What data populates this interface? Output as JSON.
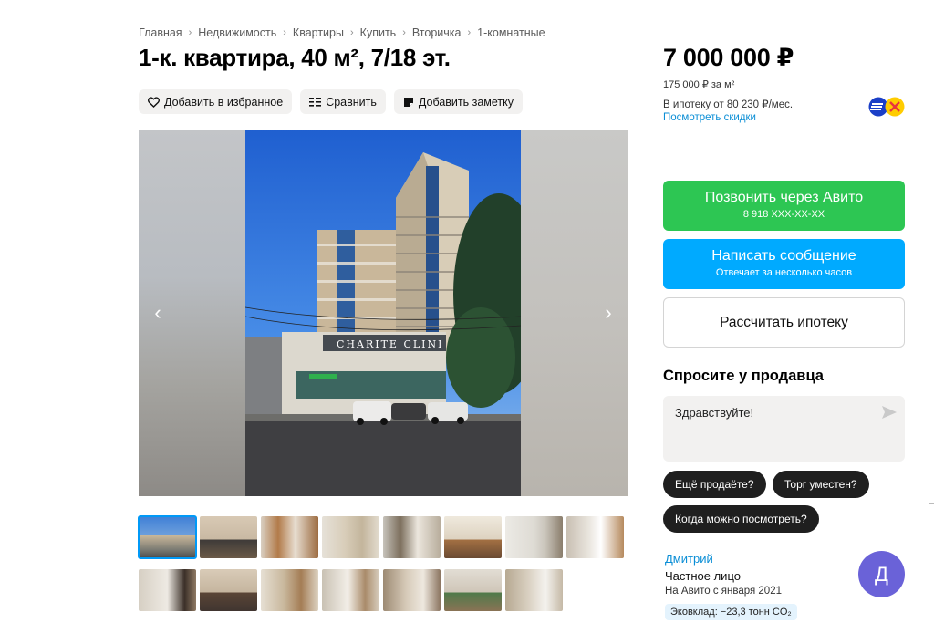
{
  "breadcrumb": [
    "Главная",
    "Недвижимость",
    "Квартиры",
    "Купить",
    "Вторичка",
    "1-комнатные"
  ],
  "title": "1-к. квартира, 40 м², 7/18 эт.",
  "actions": {
    "favorite": "Добавить в избранное",
    "compare": "Сравнить",
    "note": "Добавить заметку"
  },
  "gallery": {
    "facade_sign": "CHARITE CLINI"
  },
  "price": {
    "total": "7 000 000 ₽",
    "per_m2": "175 000 ₽ за м²",
    "mortgage": "В ипотеку от 80 230 ₽/мес.",
    "discount_link": "Посмотреть скидки"
  },
  "buttons": {
    "call_label": "Позвонить через Авито",
    "call_phone": "8 918 XXX-XX-XX",
    "message_label": "Написать сообщение",
    "message_sub": "Отвечает за несколько часов",
    "mortgage_calc": "Рассчитать ипотеку"
  },
  "ask": {
    "title": "Спросите у продавца",
    "message": "Здравствуйте!",
    "chips": [
      "Ещё продаёте?",
      "Торг уместен?",
      "Когда можно посмотреть?"
    ]
  },
  "seller": {
    "name": "Дмитрий",
    "type": "Частное лицо",
    "since": "На Авито с января 2021",
    "eco": "Эковклад: −23,3 тонн CO₂",
    "avatar_letter": "Д"
  },
  "colors": {
    "call": "#2dc653",
    "message": "#00aaff",
    "link": "#0a8ed6",
    "chip": "#1f1f1f",
    "avatar": "#6a62d8"
  },
  "thumbnails_count": 15
}
